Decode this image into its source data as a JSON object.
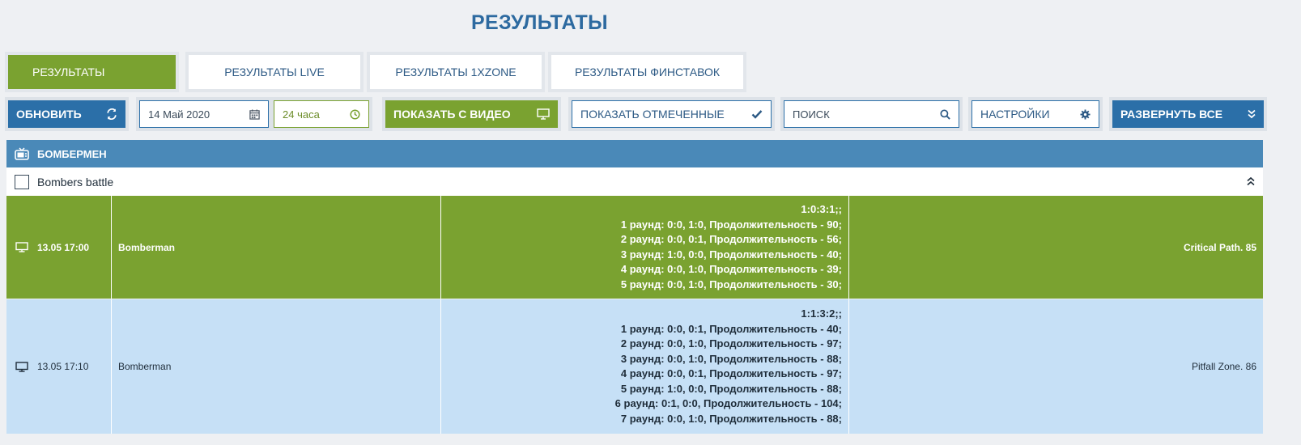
{
  "page": {
    "title": "РЕЗУЛЬТАТЫ"
  },
  "tabs": [
    {
      "label": "РЕЗУЛЬТАТЫ",
      "active": true
    },
    {
      "label": "РЕЗУЛЬТАТЫ LIVE",
      "active": false
    },
    {
      "label": "РЕЗУЛЬТАТЫ 1XZONE",
      "active": false
    },
    {
      "label": "РЕЗУЛЬТАТЫ ФИНСТАВОК",
      "active": false
    }
  ],
  "toolbar": {
    "refresh_label": "ОБНОВИТЬ",
    "date_value": "14 Май 2020",
    "period_value": "24 часа",
    "show_video_label": "ПОКАЗАТЬ С ВИДЕО",
    "show_marked_label": "ПОКАЗАТЬ ОТМЕЧЕННЫЕ",
    "search_placeholder": "ПОИСК",
    "settings_label": "НАСТРОЙКИ",
    "expand_all_label": "РАЗВЕРНУТЬ ВСЕ"
  },
  "sport": {
    "name": "БОМБЕРМЕН"
  },
  "league": {
    "name": "Bombers battle"
  },
  "matches": [
    {
      "time": "13.05 17:00",
      "name": "Bomberman",
      "score_lines": [
        "1:0:3:1;;",
        "1 раунд: 0:0, 1:0, Продолжительность - 90;",
        "2 раунд: 0:0, 0:1, Продолжительность - 56;",
        "3 раунд: 1:0, 0:0, Продолжительность - 40;",
        "4 раунд: 0:0, 1:0, Продолжительность - 39;",
        "5 раунд: 0:0, 1:0, Продолжительность - 30;"
      ],
      "winner": "Critical Path. 85"
    },
    {
      "time": "13.05 17:10",
      "name": "Bomberman",
      "score_lines": [
        "1:1:3:2;;",
        "1 раунд: 0:0, 0:1, Продолжительность - 40;",
        "2 раунд: 0:0, 1:0, Продолжительность - 97;",
        "3 раунд: 0:0, 1:0, Продолжительность - 88;",
        "4 раунд: 0:0, 0:1, Продолжительность - 97;",
        "5 раунд: 1:0, 0:0, Продолжительность - 88;",
        "6 раунд: 0:1, 0:0, Продолжительность - 104;",
        "7 раунд: 0:0, 1:0, Продолжительность - 88;"
      ],
      "winner": "Pitfall Zone. 86"
    }
  ],
  "colors": {
    "accent_green": "#7aa230",
    "accent_blue": "#2b6fa8",
    "header_blue": "#4a89b8",
    "row_blue": "#c6e0f6"
  }
}
